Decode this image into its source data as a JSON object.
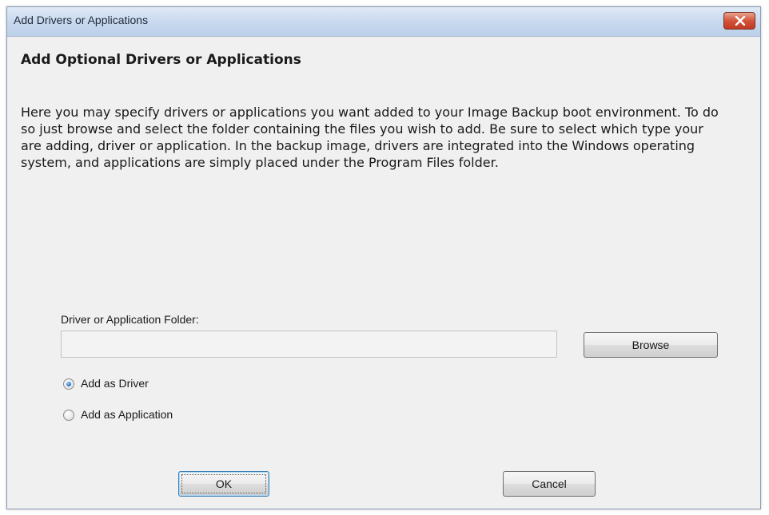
{
  "window": {
    "title": "Add Drivers or Applications"
  },
  "page": {
    "heading": "Add Optional Drivers or Applications",
    "description": "Here you may specify drivers or applications you want added to your Image Backup boot environment. To do so just browse and select the folder containing the files you wish to add. Be sure to select which type your are adding, driver or application. In the backup image, drivers are integrated into the Windows operating system, and applications are simply placed under the Program Files folder."
  },
  "folder": {
    "label": "Driver or Application Folder:",
    "value": "",
    "browse_label": "Browse"
  },
  "options": [
    {
      "label": "Add as Driver",
      "selected": true
    },
    {
      "label": "Add as Application",
      "selected": false
    }
  ],
  "buttons": {
    "ok_label": "OK",
    "cancel_label": "Cancel"
  },
  "colors": {
    "close_button": "#d3533a",
    "titlebar": "#c9d9ee",
    "radio_selected": "#2a78c8"
  },
  "icons": {
    "close": "close-icon"
  }
}
